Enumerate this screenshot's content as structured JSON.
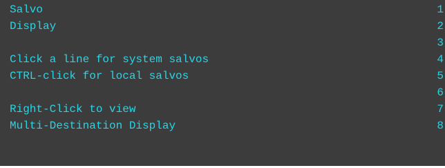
{
  "colors": {
    "background": "#3c3c3c",
    "text": "#29d4e6"
  },
  "lines": [
    {
      "text": "Salvo",
      "number": "1"
    },
    {
      "text": "Display",
      "number": "2"
    },
    {
      "text": "",
      "number": "3"
    },
    {
      "text": "Click a line for system salvos",
      "number": "4"
    },
    {
      "text": "CTRL-click for local salvos",
      "number": "5"
    },
    {
      "text": "",
      "number": "6"
    },
    {
      "text": "Right-Click to view",
      "number": "7"
    },
    {
      "text": "Multi-Destination Display",
      "number": "8"
    }
  ]
}
